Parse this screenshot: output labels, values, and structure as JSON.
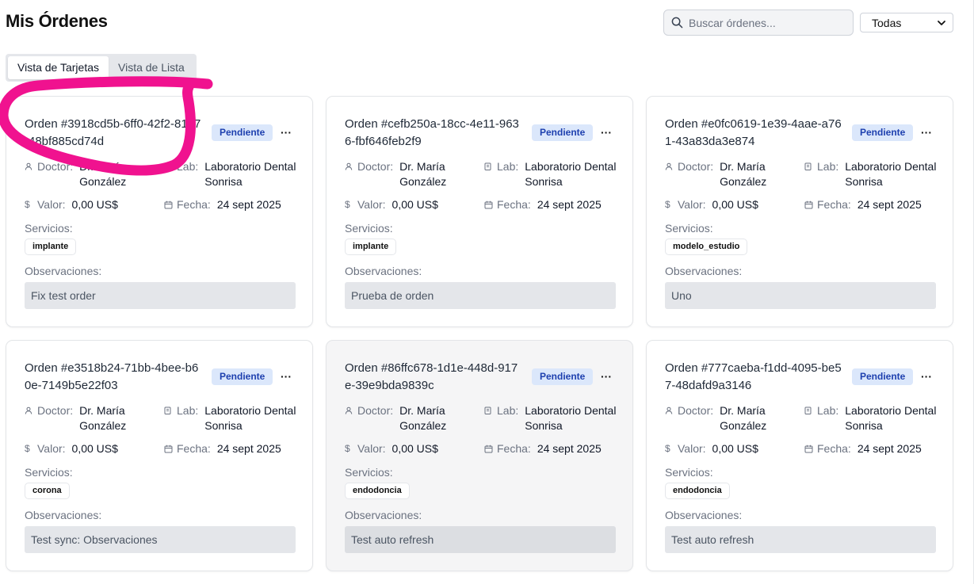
{
  "header": {
    "title": "Mis Órdenes",
    "search_placeholder": "Buscar órdenes...",
    "filter_value": "Todas"
  },
  "tabs": [
    {
      "label": "Vista de Tarjetas",
      "active": true
    },
    {
      "label": "Vista de Lista",
      "active": false
    }
  ],
  "labels": {
    "doctor": "Doctor:",
    "lab": "Lab:",
    "valor": "Valor:",
    "fecha": "Fecha:",
    "servicios": "Servicios:",
    "observaciones": "Observaciones:"
  },
  "orders": [
    {
      "title": "Orden #3918cd5b-6ff0-42f2-81b7-48bf885cd74d",
      "status": "Pendiente",
      "doctor": "Dr. María González",
      "lab": "Laboratorio Dental Sonrisa",
      "valor": "0,00 US$",
      "fecha": "24 sept 2025",
      "servicio": "implante",
      "observaciones": "Fix test order"
    },
    {
      "title": "Orden #cefb250a-18cc-4e11-9636-fbf646feb2f9",
      "status": "Pendiente",
      "doctor": "Dr. María González",
      "lab": "Laboratorio Dental Sonrisa",
      "valor": "0,00 US$",
      "fecha": "24 sept 2025",
      "servicio": "implante",
      "observaciones": "Prueba de orden"
    },
    {
      "title": "Orden #e0fc0619-1e39-4aae-a761-43a83da3e874",
      "status": "Pendiente",
      "doctor": "Dr. María González",
      "lab": "Laboratorio Dental Sonrisa",
      "valor": "0,00 US$",
      "fecha": "24 sept 2025",
      "servicio": "modelo_estudio",
      "observaciones": "Uno"
    },
    {
      "title": "Orden #e3518b24-71bb-4bee-b60e-7149b5e22f03",
      "status": "Pendiente",
      "doctor": "Dr. María González",
      "lab": "Laboratorio Dental Sonrisa",
      "valor": "0,00 US$",
      "fecha": "24 sept 2025",
      "servicio": "corona",
      "observaciones": "Test sync: Observaciones"
    },
    {
      "title": "Orden #86ffc678-1d1e-448d-917e-39e9bda9839c",
      "status": "Pendiente",
      "doctor": "Dr. María González",
      "lab": "Laboratorio Dental Sonrisa",
      "valor": "0,00 US$",
      "fecha": "24 sept 2025",
      "servicio": "endodoncia",
      "observaciones": "Test auto refresh"
    },
    {
      "title": "Orden #777caeba-f1dd-4095-be57-48dafd9a3146",
      "status": "Pendiente",
      "doctor": "Dr. María González",
      "lab": "Laboratorio Dental Sonrisa",
      "valor": "0,00 US$",
      "fecha": "24 sept 2025",
      "servicio": "endodoncia",
      "observaciones": "Test auto refresh"
    }
  ],
  "colors": {
    "annotation": "#f0128f",
    "badge_bg": "#dbe7fb",
    "badge_text": "#1e40af"
  }
}
